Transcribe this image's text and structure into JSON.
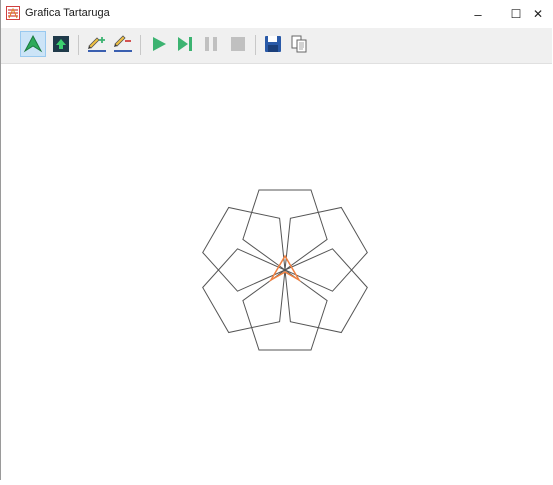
{
  "window": {
    "title": "Grafica Tartaruga",
    "controls": {
      "minimize": "–",
      "maximize": "☐",
      "close": "✕"
    }
  },
  "toolbar": {
    "buttons": [
      {
        "name": "turtle-visible-button",
        "icon": "turtle-arrow-icon",
        "active": true
      },
      {
        "name": "turtle-up-button",
        "icon": "up-arrow-square-icon",
        "active": false
      },
      {
        "name": "pen-down-button",
        "icon": "pen-down-icon",
        "active": false
      },
      {
        "name": "pen-up-button",
        "icon": "pen-up-icon",
        "active": false
      },
      {
        "name": "run-button",
        "icon": "play-icon",
        "active": false
      },
      {
        "name": "step-button",
        "icon": "step-forward-icon",
        "active": false
      },
      {
        "name": "pause-button",
        "icon": "pause-icon",
        "active": false
      },
      {
        "name": "stop-button",
        "icon": "stop-icon",
        "active": false
      },
      {
        "name": "save-button",
        "icon": "floppy-disk-icon",
        "active": false
      },
      {
        "name": "copy-button",
        "icon": "copy-icon",
        "active": false
      }
    ]
  },
  "drawing": {
    "shape": "pentagon",
    "repeat_count": 6,
    "rotation_step_deg": 60,
    "line_color": "#555555",
    "turtle_color": "#f08040"
  },
  "colors": {
    "accent_green": "#3cb371",
    "toolbar_bg": "#f0f0f0",
    "active_bg": "#cce4f7"
  }
}
